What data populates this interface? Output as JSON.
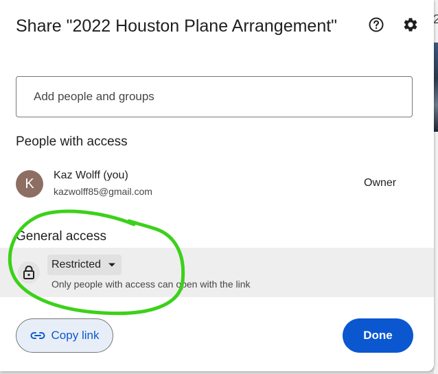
{
  "dialog": {
    "title": "Share \"2022 Houston Plane Arrangement\""
  },
  "header_actions": {
    "help_icon": "help-circle-icon",
    "settings_icon": "gear-icon"
  },
  "add_people": {
    "placeholder": "Add people and groups",
    "value": ""
  },
  "people_with_access": {
    "heading": "People with access",
    "people": [
      {
        "initial": "K",
        "name": "Kaz Wolff (you)",
        "email": "kazwolff85@gmail.com",
        "role": "Owner",
        "avatar_color": "#8d6e63"
      }
    ]
  },
  "general_access": {
    "heading": "General access",
    "icon": "lock-icon",
    "selected": "Restricted",
    "description": "Only people with access can open with the link"
  },
  "footer": {
    "copy_link_label": "Copy link",
    "copy_link_icon": "link-icon",
    "done_label": "Done"
  },
  "background": {
    "visible_char": "2"
  },
  "colors": {
    "accent": "#0b57d0",
    "annotation": "#3cd11a",
    "access_row_bg": "#eeeeee"
  }
}
